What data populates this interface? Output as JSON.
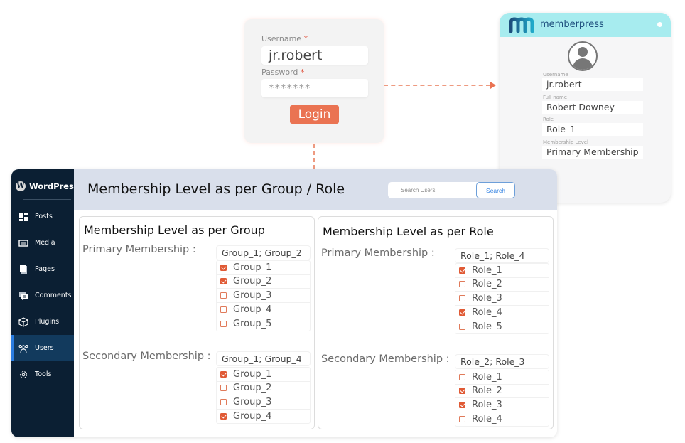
{
  "login": {
    "username_label": "Username",
    "password_label": "Password",
    "required_mark": "*",
    "username_value": "jr.robert",
    "password_value": "*******",
    "login_button": "Login"
  },
  "profile": {
    "brand": "memberpress",
    "fields": [
      {
        "label": "Username",
        "value": "jr.robert"
      },
      {
        "label": "Full name",
        "value": "Robert Downey"
      },
      {
        "label": "Role",
        "value": "Role_1"
      },
      {
        "label": "Membership Level",
        "value": "Primary Membership"
      }
    ]
  },
  "wp": {
    "brand": "WordPress",
    "sidebar": [
      {
        "label": "Posts",
        "icon": "posts-icon",
        "active": false
      },
      {
        "label": "Media",
        "icon": "media-icon",
        "active": false
      },
      {
        "label": "Pages",
        "icon": "pages-icon",
        "active": false
      },
      {
        "label": "Comments",
        "icon": "comments-icon",
        "active": false
      },
      {
        "label": "Plugins",
        "icon": "plugins-icon",
        "active": false
      },
      {
        "label": "Users",
        "icon": "users-icon",
        "active": true
      },
      {
        "label": "Tools",
        "icon": "tools-icon",
        "active": false
      }
    ],
    "page_title": "Membership Level as per Group / Role",
    "search": {
      "placeholder": "Search Users",
      "button": "Search"
    },
    "group_panel": {
      "title": "Membership Level as per Group",
      "primary": {
        "label": "Primary Membership :",
        "value": "Group_1; Group_2",
        "options": [
          {
            "label": "Group_1",
            "checked": true
          },
          {
            "label": "Group_2",
            "checked": true
          },
          {
            "label": "Group_3",
            "checked": false
          },
          {
            "label": "Group_4",
            "checked": false
          },
          {
            "label": "Group_5",
            "checked": false
          }
        ]
      },
      "secondary": {
        "label": "Secondary Membership :",
        "value": "Group_1; Group_4",
        "options": [
          {
            "label": "Group_1",
            "checked": true
          },
          {
            "label": "Group_2",
            "checked": false
          },
          {
            "label": "Group_3",
            "checked": false
          },
          {
            "label": "Group_4",
            "checked": true
          }
        ]
      }
    },
    "role_panel": {
      "title": "Membership Level as per Role",
      "primary": {
        "label": "Primary Membership :",
        "value": "Role_1; Role_4",
        "options": [
          {
            "label": "Role_1",
            "checked": true
          },
          {
            "label": "Role_2",
            "checked": false
          },
          {
            "label": "Role_3",
            "checked": false
          },
          {
            "label": "Role_4",
            "checked": true
          },
          {
            "label": "Role_5",
            "checked": false
          }
        ]
      },
      "secondary": {
        "label": "Secondary Membership :",
        "value": "Role_2; Role_3",
        "options": [
          {
            "label": "Role_1",
            "checked": false
          },
          {
            "label": "Role_2",
            "checked": true
          },
          {
            "label": "Role_3",
            "checked": true
          },
          {
            "label": "Role_4",
            "checked": false
          }
        ]
      }
    }
  },
  "colors": {
    "accent_orange": "#ea7352",
    "checkbox_checked": "#e05a35",
    "sidebar_bg": "#0b1f33",
    "sidebar_active": "#123a5d",
    "header_bg": "#d9dfeb",
    "memberpress_header": "#a7ecef",
    "search_blue": "#2a7de1"
  }
}
